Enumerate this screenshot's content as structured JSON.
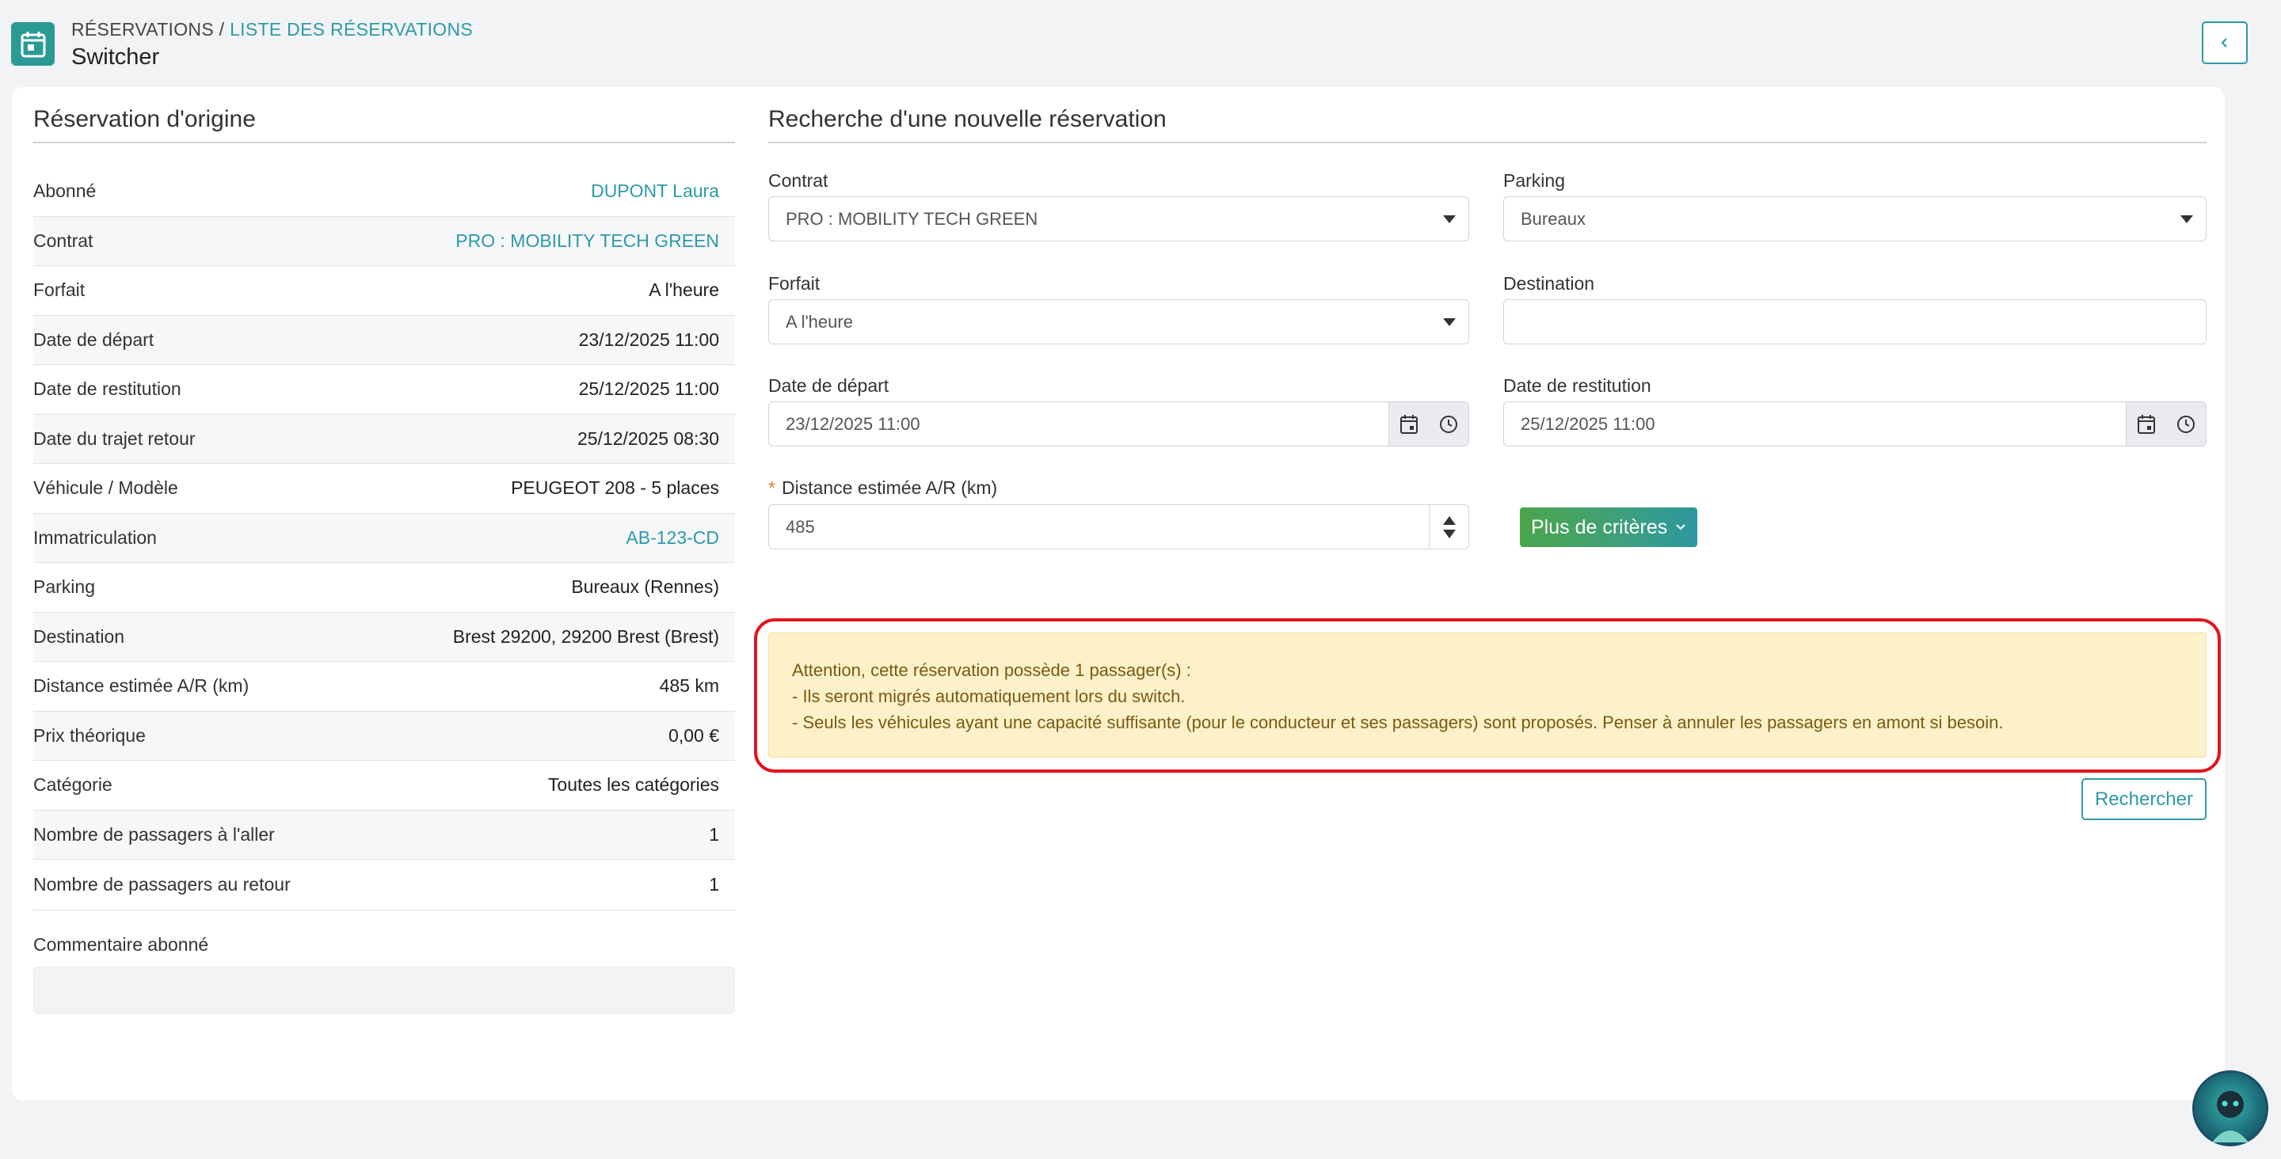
{
  "header": {
    "breadcrumb_root": "RÉSERVATIONS",
    "breadcrumb_sep": " / ",
    "breadcrumb_link": "LISTE DES RÉSERVATIONS",
    "title": "Switcher"
  },
  "origin": {
    "title": "Réservation d'origine",
    "rows": [
      {
        "label": "Abonné",
        "value": "DUPONT Laura"
      },
      {
        "label": "Contrat",
        "value": "PRO : MOBILITY TECH GREEN"
      },
      {
        "label": "Forfait",
        "value": "A l'heure"
      },
      {
        "label": "Date de départ",
        "value": "23/12/2025 11:00"
      },
      {
        "label": "Date de restitution",
        "value": "25/12/2025 11:00"
      },
      {
        "label": "Date du trajet retour",
        "value": "25/12/2025 08:30"
      },
      {
        "label": "Véhicule / Modèle",
        "value": "PEUGEOT 208 - 5 places"
      },
      {
        "label": "Immatriculation",
        "value": "AB-123-CD"
      },
      {
        "label": "Parking",
        "value": "Bureaux (Rennes)"
      },
      {
        "label": "Destination",
        "value": "Brest 29200, 29200 Brest (Brest)"
      },
      {
        "label": "Distance estimée A/R (km)",
        "value": "485 km"
      },
      {
        "label": "Prix théorique",
        "value": "0,00 €"
      },
      {
        "label": "Catégorie",
        "value": "Toutes les catégories"
      },
      {
        "label": "Nombre de passagers à l'aller",
        "value": "1"
      },
      {
        "label": "Nombre de passagers au retour",
        "value": "1"
      }
    ],
    "comment_label": "Commentaire abonné"
  },
  "search": {
    "title": "Recherche d'une nouvelle réservation",
    "contrat_label": "Contrat",
    "contrat_value": "PRO : MOBILITY TECH GREEN",
    "parking_label": "Parking",
    "parking_value": "Bureaux",
    "forfait_label": "Forfait",
    "forfait_value": "A l'heure",
    "destination_label": "Destination",
    "destination_value": "",
    "depart_label": "Date de départ",
    "depart_value": "23/12/2025 11:00",
    "restitution_label": "Date de restitution",
    "restitution_value": "25/12/2025 11:00",
    "required_mark": "*",
    "distance_label": "Distance estimée A/R (km)",
    "distance_value": "485",
    "more_criteria": "Plus de critères",
    "alert_line1": "Attention, cette réservation possède 1 passager(s) :",
    "alert_line2": "- Ils seront migrés automatiquement lors du switch.",
    "alert_line3": "- Seuls les véhicules ayant une capacité suffisante (pour le conducteur et ses passagers) sont proposés. Penser à annuler les passagers en amont si besoin.",
    "search_button": "Rechercher"
  },
  "colors": {
    "accent": "#2d9aa8",
    "alert_bg": "#fdf1c9",
    "highlight": "#e3141c",
    "button_green": "#4aa54a"
  }
}
